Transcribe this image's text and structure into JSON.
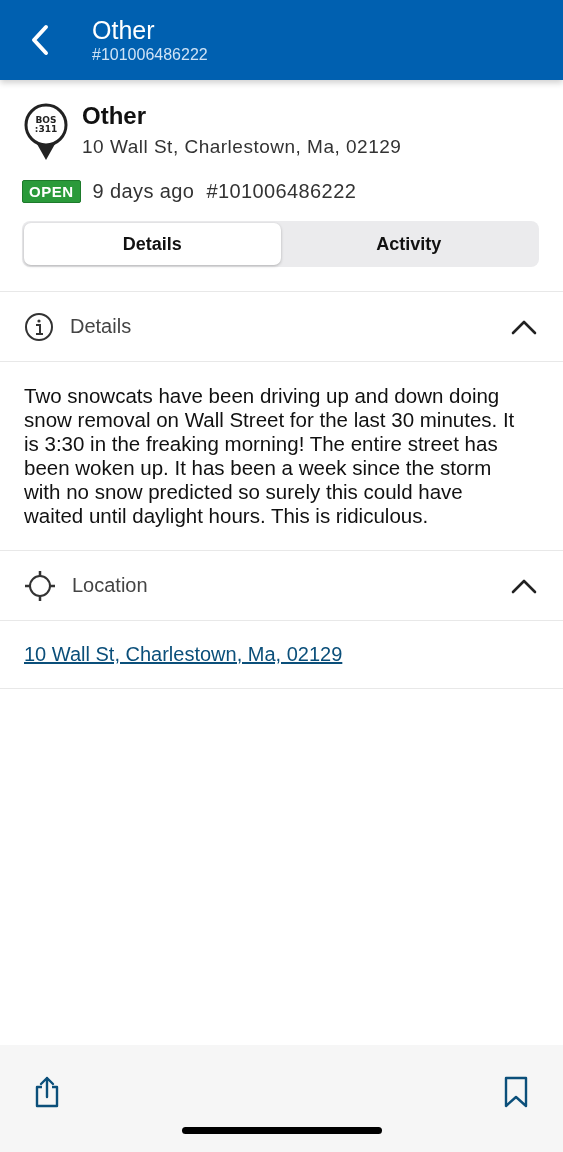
{
  "header": {
    "title": "Other",
    "subtitle": "#101006486222"
  },
  "summary": {
    "logo_lines": [
      "BOS",
      ":311"
    ],
    "title": "Other",
    "address": "10 Wall St, Charlestown, Ma, 02129",
    "status": "OPEN",
    "age": "9 days ago",
    "number": "#101006486222"
  },
  "tabs": [
    {
      "label": "Details",
      "selected": true
    },
    {
      "label": "Activity",
      "selected": false
    }
  ],
  "sections": [
    {
      "kind": "info",
      "title": "Details",
      "expanded": true,
      "body": {
        "kind": "text",
        "text": "Two snowcats have been driving up and down doing snow removal on Wall Street for the last 30 minutes. It is 3:30 in the freaking morning! The entire street has been woken up. It has been a week since the storm with no snow predicted so surely this could have waited until daylight hours. This is ridiculous."
      }
    },
    {
      "kind": "location",
      "title": "Location",
      "expanded": true,
      "body": {
        "kind": "link",
        "text": "10 Wall St, Charlestown, Ma, 02129"
      }
    }
  ]
}
